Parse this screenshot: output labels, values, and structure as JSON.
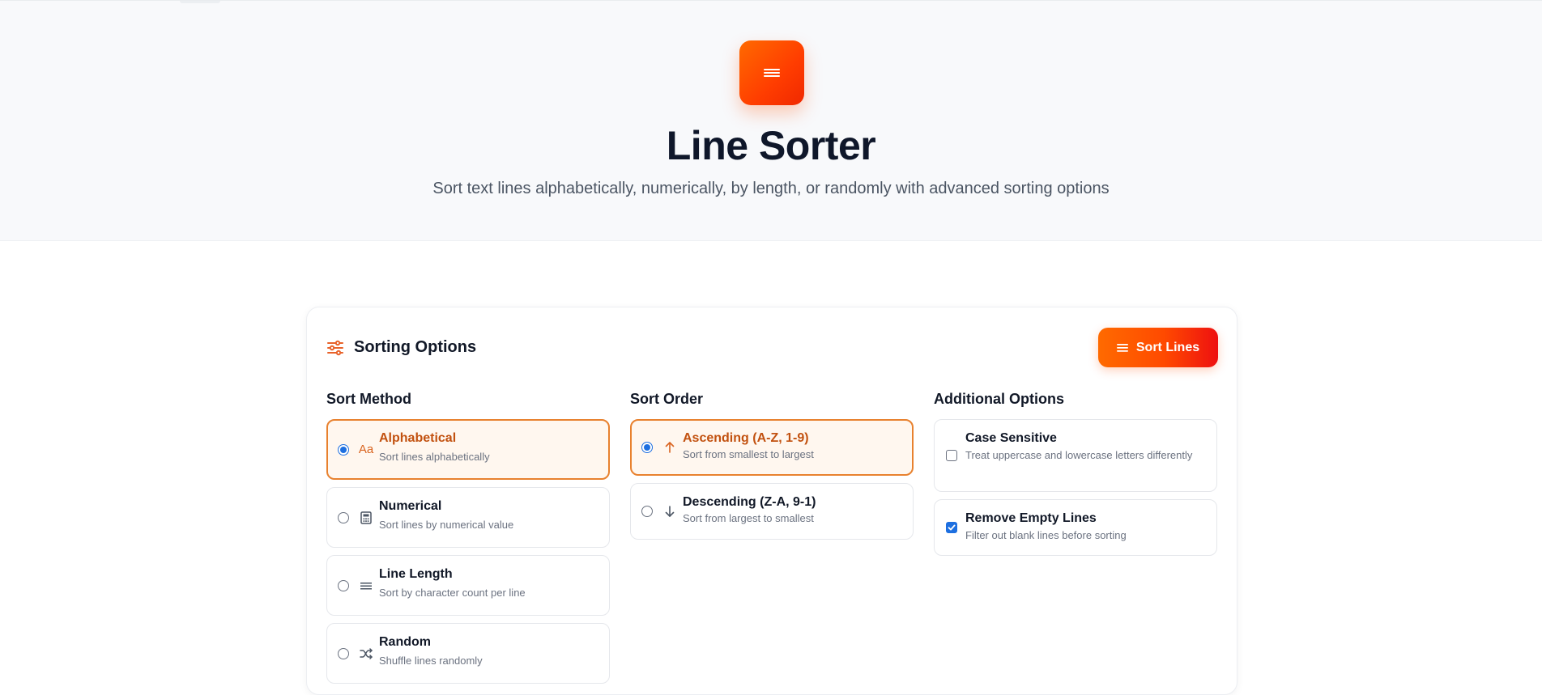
{
  "hero": {
    "title": "Line Sorter",
    "subtitle": "Sort text lines alphabetically, numerically, by length, or randomly with advanced sorting options",
    "logo_icon": "lines-icon"
  },
  "card": {
    "title": "Sorting Options",
    "title_icon": "sliders-icon",
    "sort_button_label": "Sort Lines",
    "sort_button_icon": "lines-icon"
  },
  "sort_method": {
    "heading": "Sort Method",
    "options": [
      {
        "title": "Alphabetical",
        "desc": "Sort lines alphabetically",
        "icon": "Aa",
        "selected": true
      },
      {
        "title": "Numerical",
        "desc": "Sort lines by numerical value",
        "icon": "calculator-icon",
        "selected": false
      },
      {
        "title": "Line Length",
        "desc": "Sort by character count per line",
        "icon": "lines-icon",
        "selected": false
      },
      {
        "title": "Random",
        "desc": "Shuffle lines randomly",
        "icon": "shuffle-icon",
        "selected": false
      }
    ]
  },
  "sort_order": {
    "heading": "Sort Order",
    "options": [
      {
        "title": "Ascending (A-Z, 1-9)",
        "desc": "Sort from smallest to largest",
        "icon": "arrow-up-icon",
        "selected": true
      },
      {
        "title": "Descending (Z-A, 9-1)",
        "desc": "Sort from largest to smallest",
        "icon": "arrow-down-icon",
        "selected": false
      }
    ]
  },
  "additional": {
    "heading": "Additional Options",
    "options": [
      {
        "title": "Case Sensitive",
        "desc": "Treat uppercase and lowercase letters differently",
        "checked": false
      },
      {
        "title": "Remove Empty Lines",
        "desc": "Filter out blank lines before sorting",
        "checked": true
      }
    ]
  },
  "colors": {
    "accent": "#ff5a00",
    "accent_dark": "#c2510f",
    "selected_bg": "#fff7ef",
    "checkbox_blue": "#1d6fe0"
  }
}
